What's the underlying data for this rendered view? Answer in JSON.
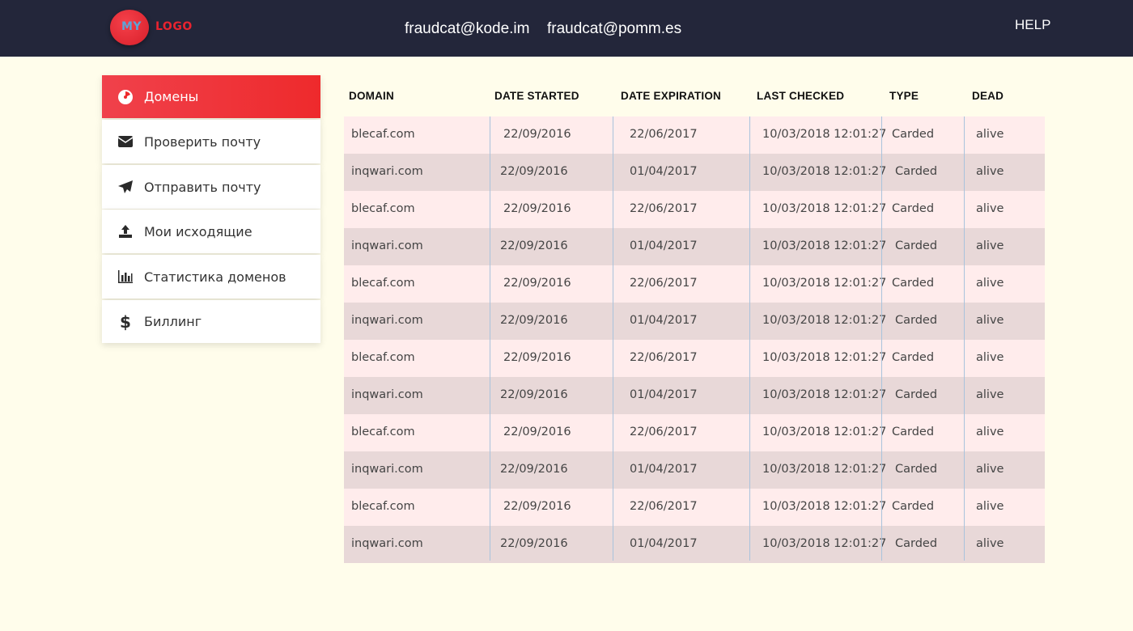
{
  "header": {
    "logo_my": "MY",
    "logo_text": "LOGO",
    "emails": [
      "fraudcat@kode.im",
      "fraudcat@pomm.es"
    ],
    "help": "HELP"
  },
  "sidebar": {
    "items": [
      {
        "label": "Домены",
        "icon": "pie-chart-icon",
        "active": true
      },
      {
        "label": "Проверить почту",
        "icon": "envelope-icon",
        "active": false
      },
      {
        "label": "Отправить почту",
        "icon": "paper-plane-icon",
        "active": false
      },
      {
        "label": "Мои исходящие",
        "icon": "upload-icon",
        "active": false
      },
      {
        "label": "Статистика доменов",
        "icon": "bar-chart-icon",
        "active": false
      },
      {
        "label": "Биллинг",
        "icon": "dollar-icon",
        "active": false
      }
    ]
  },
  "table": {
    "columns": [
      "DOMAIN",
      "DATE STARTED",
      "DATE EXPIRATION",
      "LAST CHECKED",
      "TYPE",
      "DEAD"
    ],
    "rows": [
      [
        "blecaf.com",
        "22/09/2016",
        "22/06/2017",
        "10/03/2018 12:01:27",
        "Carded",
        "alive"
      ],
      [
        "inqwari.com",
        "22/09/2016",
        "01/04/2017",
        "10/03/2018 12:01:27",
        "Carded",
        "alive"
      ],
      [
        "blecaf.com",
        "22/09/2016",
        "22/06/2017",
        "10/03/2018 12:01:27",
        "Carded",
        "alive"
      ],
      [
        "inqwari.com",
        "22/09/2016",
        "01/04/2017",
        "10/03/2018 12:01:27",
        "Carded",
        "alive"
      ],
      [
        "blecaf.com",
        "22/09/2016",
        "22/06/2017",
        "10/03/2018 12:01:27",
        "Carded",
        "alive"
      ],
      [
        "inqwari.com",
        "22/09/2016",
        "01/04/2017",
        "10/03/2018 12:01:27",
        "Carded",
        "alive"
      ],
      [
        "blecaf.com",
        "22/09/2016",
        "22/06/2017",
        "10/03/2018 12:01:27",
        "Carded",
        "alive"
      ],
      [
        "inqwari.com",
        "22/09/2016",
        "01/04/2017",
        "10/03/2018 12:01:27",
        "Carded",
        "alive"
      ],
      [
        "blecaf.com",
        "22/09/2016",
        "22/06/2017",
        "10/03/2018 12:01:27",
        "Carded",
        "alive"
      ],
      [
        "inqwari.com",
        "22/09/2016",
        "01/04/2017",
        "10/03/2018 12:01:27",
        "Carded",
        "alive"
      ],
      [
        "blecaf.com",
        "22/09/2016",
        "22/06/2017",
        "10/03/2018 12:01:27",
        "Carded",
        "alive"
      ],
      [
        "inqwari.com",
        "22/09/2016",
        "01/04/2017",
        "10/03/2018 12:01:27",
        "Carded",
        "alive"
      ]
    ]
  },
  "colors": {
    "header_bg": "#23263a",
    "page_bg": "#fffdeb",
    "accent": "#ee2a2c",
    "row_odd": "#ffecec",
    "row_even": "#e8d8d8"
  }
}
